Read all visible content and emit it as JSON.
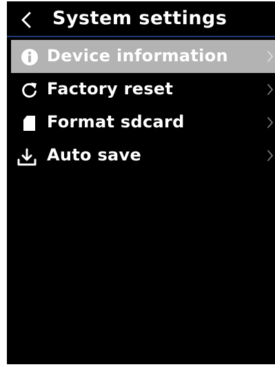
{
  "header": {
    "title": "System settings",
    "back_icon": "chevron-left-icon"
  },
  "menu": {
    "items": [
      {
        "label": "Device information",
        "icon": "info-icon",
        "selected": true
      },
      {
        "label": "Factory reset",
        "icon": "refresh-icon",
        "selected": false
      },
      {
        "label": "Format sdcard",
        "icon": "sdcard-icon",
        "selected": false
      },
      {
        "label": "Auto save",
        "icon": "download-icon",
        "selected": false
      }
    ]
  },
  "colors": {
    "background": "#000000",
    "text": "#ffffff",
    "selected_row": "#b3b3b3",
    "header_divider": "#1f3a78",
    "chevron": "#6e6e6e"
  }
}
